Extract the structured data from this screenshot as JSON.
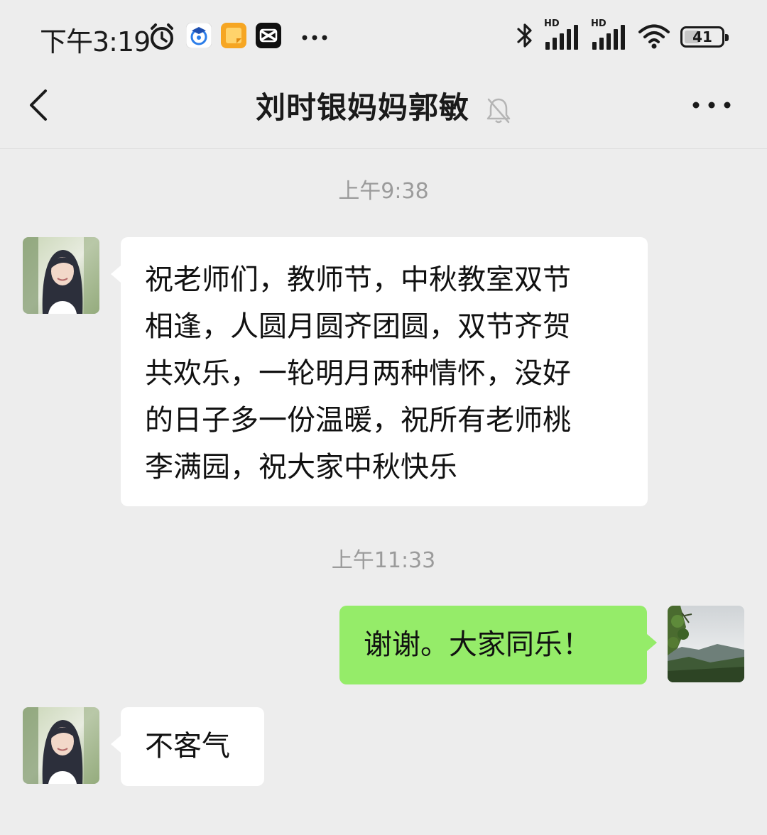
{
  "status_bar": {
    "time": "下午3:19",
    "icons": [
      "alarm-icon",
      "campus-app-icon",
      "notes-app-icon",
      "capcut-app-icon",
      "more-notifications-icon"
    ],
    "right_icons": [
      "bluetooth-icon",
      "signal-hd-icon",
      "signal-hd-icon",
      "wifi-icon",
      "battery-icon"
    ],
    "network_tag_1": "HD",
    "network_tag_2": "HD",
    "battery": "41",
    "battery_level_percent": 41
  },
  "header": {
    "title": "刘时银妈妈郭敏",
    "muted": true,
    "back_icon": "chevron-left-icon",
    "more_icon": "more-horizontal-icon"
  },
  "messages": [
    {
      "timestamp": "上午9:38",
      "side": "left",
      "avatar": "contact-avatar",
      "lines": [
        "祝老师们，教师节，中秋教室双节",
        "相逢，人圆月圆齐团圆，双节齐贺",
        "共欢乐，一轮明月两种情怀，没好",
        "的日子多一份温暖，祝所有老师桃",
        "李满园，祝大家中秋快乐"
      ]
    },
    {
      "timestamp": "上午11:33",
      "side": "right",
      "avatar": "self-avatar",
      "text": "谢谢。大家同乐！"
    },
    {
      "side": "left",
      "avatar": "contact-avatar",
      "text": "不客气"
    }
  ],
  "colors": {
    "background": "#ededed",
    "bubble_left": "#ffffff",
    "bubble_right": "#95ec69",
    "timestamp": "#9b9b9b"
  }
}
